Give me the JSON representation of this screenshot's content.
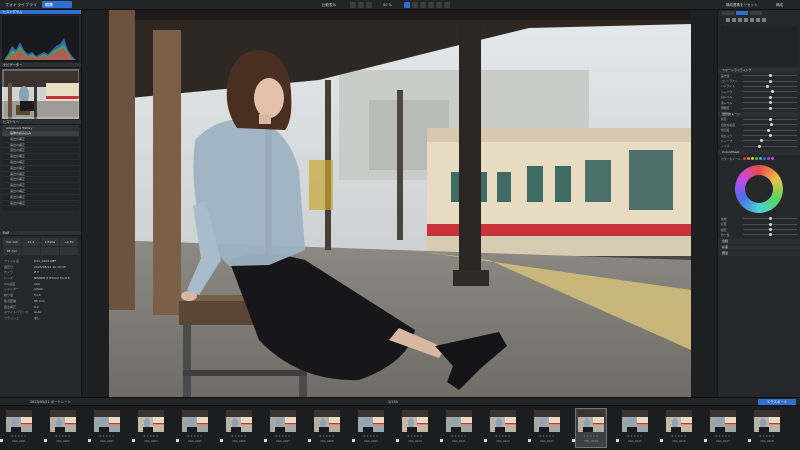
{
  "app": {
    "library_tab": "フォトライブラリ",
    "edit_tab": "編集"
  },
  "toolbar": {
    "compare_label": "比較表示",
    "zoom_label": "50 %",
    "right_label": "構成要素をリセット",
    "right_label2": "構成"
  },
  "left_panel": {
    "histogram_title": "ヒストグラム",
    "navigator_title": "ナビゲーター",
    "history_title": "ヒストリー",
    "history_header": "Advanced History",
    "history_items": [
      "画像の読み込み",
      "露出の補正",
      "露出の補正",
      "露出の補正",
      "露出の補正",
      "露出の補正",
      "露出の補正",
      "露出の補正",
      "露出の補正",
      "露出の補正",
      "露出の補正",
      "露出の補正",
      "露出の補正"
    ],
    "exif_title": "Exif",
    "camera_cells": [
      "ISO 100",
      "f/1.4",
      "1/500s",
      "+0 EV",
      "85 mm",
      "",
      "",
      ""
    ],
    "exif_rows": [
      {
        "k": "ファイル名",
        "v": "DSC_0001.NEF"
      },
      {
        "k": "撮影日",
        "v": "2023/05/21 10:15:35"
      },
      {
        "k": "カメラ",
        "v": "Z 7"
      },
      {
        "k": "レンズ",
        "v": "NIKKOR Z 85mm f/1.8 S"
      },
      {
        "k": "ISO感度",
        "v": "100"
      },
      {
        "k": "シャッター",
        "v": "1/500"
      },
      {
        "k": "絞り値",
        "v": "f/1.8"
      },
      {
        "k": "焦点距離",
        "v": "85 mm"
      },
      {
        "k": "露出補正",
        "v": "0.0"
      },
      {
        "k": "ホワイトバランス",
        "v": "Auto"
      },
      {
        "k": "フラッシュ",
        "v": "なし"
      }
    ]
  },
  "right_panel": {
    "sliders": [
      {
        "label": "露光量",
        "value": 0.5
      },
      {
        "label": "コントラスト",
        "value": 0.5
      },
      {
        "label": "ハイライト",
        "value": 0.45
      },
      {
        "label": "シャドウ",
        "value": 0.55
      },
      {
        "label": "白レベル",
        "value": 0.5
      },
      {
        "label": "黒レベル",
        "value": 0.5
      },
      {
        "label": "明瞭度",
        "value": 0.5
      },
      {
        "label": "彩度",
        "value": 0.5
      },
      {
        "label": "自然な彩度",
        "value": 0.52
      },
      {
        "label": "色温度",
        "value": 0.48
      },
      {
        "label": "色かぶり",
        "value": 0.5
      },
      {
        "label": "シャープ",
        "value": 0.35
      },
      {
        "label": "ノイズ",
        "value": 0.3
      }
    ],
    "sections": [
      "スマートライティング",
      "選択的トーン",
      "ColorWheel",
      "カラーホイール",
      "色相",
      "彩度",
      "輝度"
    ],
    "bottom_sliders": [
      {
        "label": "色相",
        "value": 0.5
      },
      {
        "label": "彩度",
        "value": 0.5
      },
      {
        "label": "輝度",
        "value": 0.5
      },
      {
        "label": "均一性",
        "value": 0.5
      }
    ]
  },
  "filmstrip": {
    "info_label": "2023/05/21 ポートレート",
    "count_label": "1/150",
    "right_label": "エクスポート",
    "thumbs": [
      "DSC_0001",
      "DSC_0002",
      "DSC_0003",
      "DSC_0004",
      "DSC_0005",
      "DSC_0006",
      "DSC_0007",
      "DSC_0008",
      "DSC_0009",
      "DSC_0010",
      "DSC_0011",
      "DSC_0012",
      "DSC_0013",
      "DSC_0014",
      "DSC_0015",
      "DSC_0016",
      "DSC_0017",
      "DSC_0018"
    ],
    "selected_index": 13
  },
  "colors": {
    "accent": "#2f6fd1",
    "train_red": "#c8323a",
    "train_cream": "#eadfc8"
  }
}
